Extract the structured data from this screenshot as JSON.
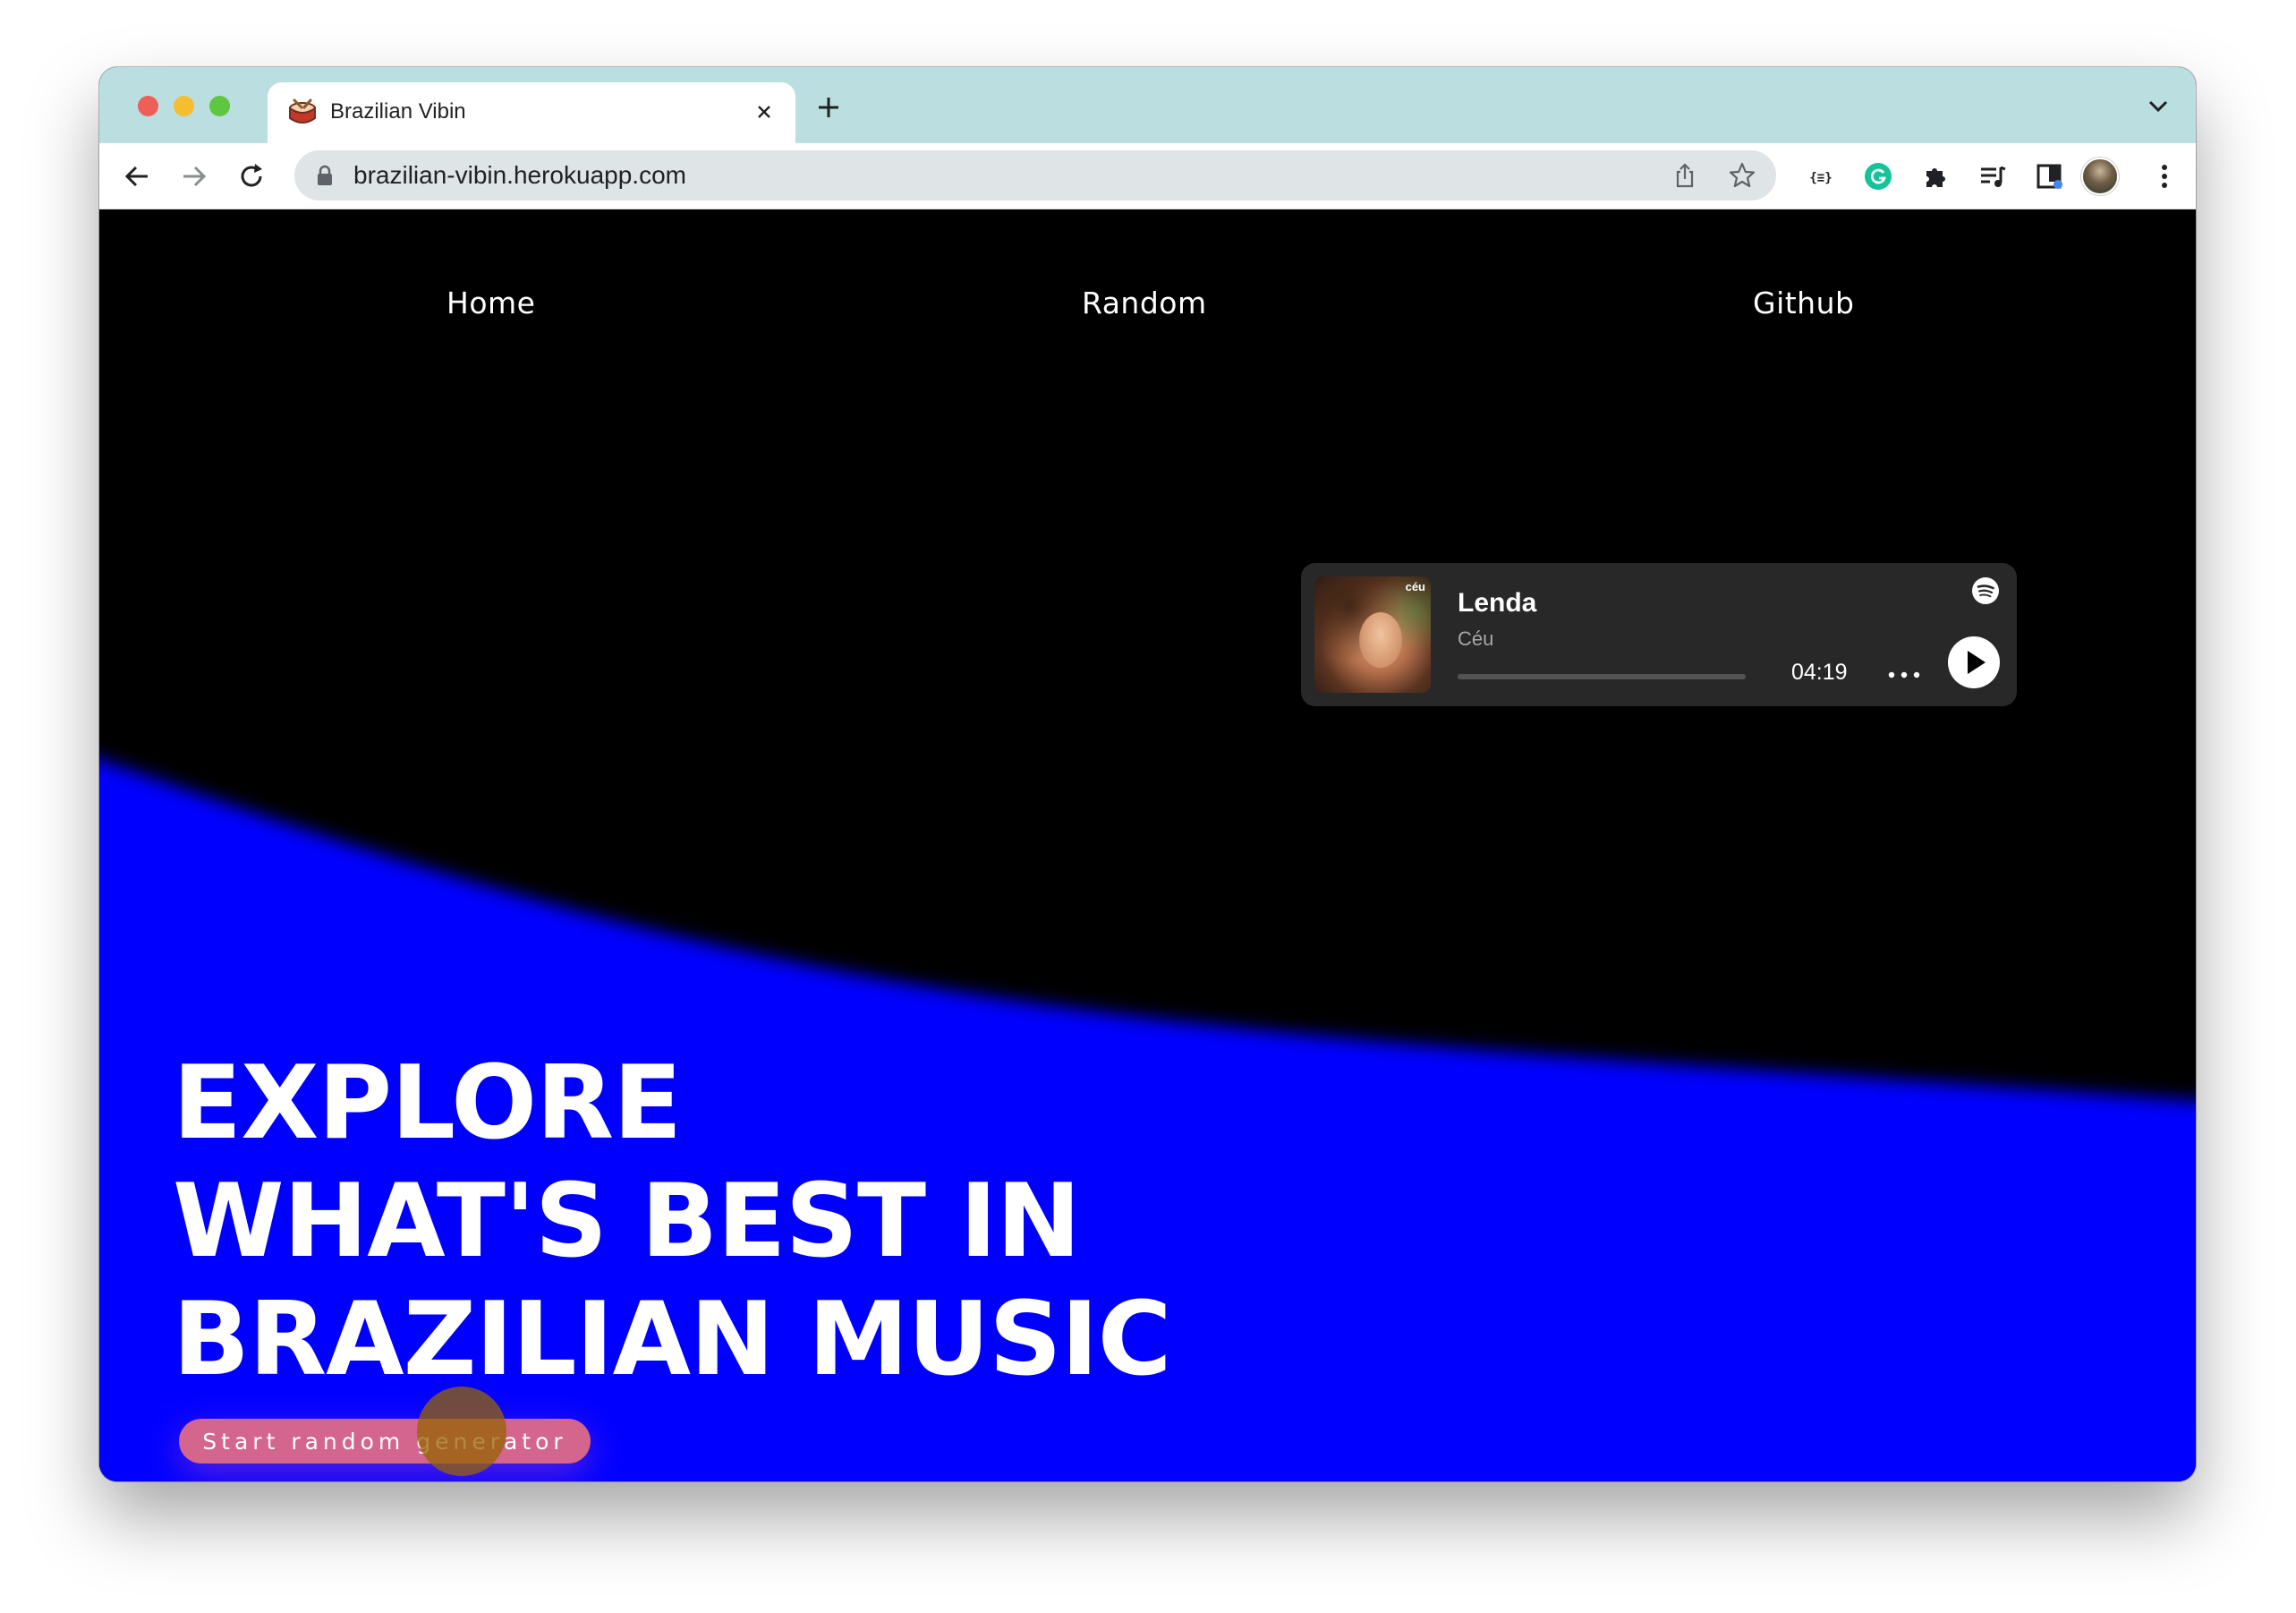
{
  "browser": {
    "tab_title": "Brazilian Vibin",
    "url": "brazilian-vibin.herokuapp.com",
    "icons": {
      "back": "arrow-left-icon",
      "forward": "arrow-right-icon",
      "reload": "reload-icon",
      "lock": "lock-icon",
      "share": "share-icon",
      "bookmark": "star-icon",
      "extensions": [
        "json-viewer-icon",
        "grammarly-icon",
        "puzzle-icon",
        "media-control-icon",
        "sidebar-icon"
      ],
      "menu": "kebab-menu-icon"
    },
    "colors": {
      "tabstrip": "#bbdfe0",
      "omnibox": "#dfe4e6"
    }
  },
  "nav": {
    "home": "Home",
    "random": "Random",
    "github": "Github"
  },
  "player": {
    "title": "Lenda",
    "artist": "Céu",
    "duration": "04:19",
    "cover_tag": "céu",
    "progress_fraction": 0,
    "colors": {
      "background": "#282828",
      "title": "#ffffff",
      "artist": "#a7a7a7"
    }
  },
  "hero": {
    "line1": "EXPLORE",
    "line2": "WHAT'S BEST IN",
    "line3": "BRAZILIAN MUSIC",
    "cta_label": "Start random generator"
  },
  "colors": {
    "background": "#000000",
    "wave": "#0000ff",
    "cta": "#d4658c"
  }
}
